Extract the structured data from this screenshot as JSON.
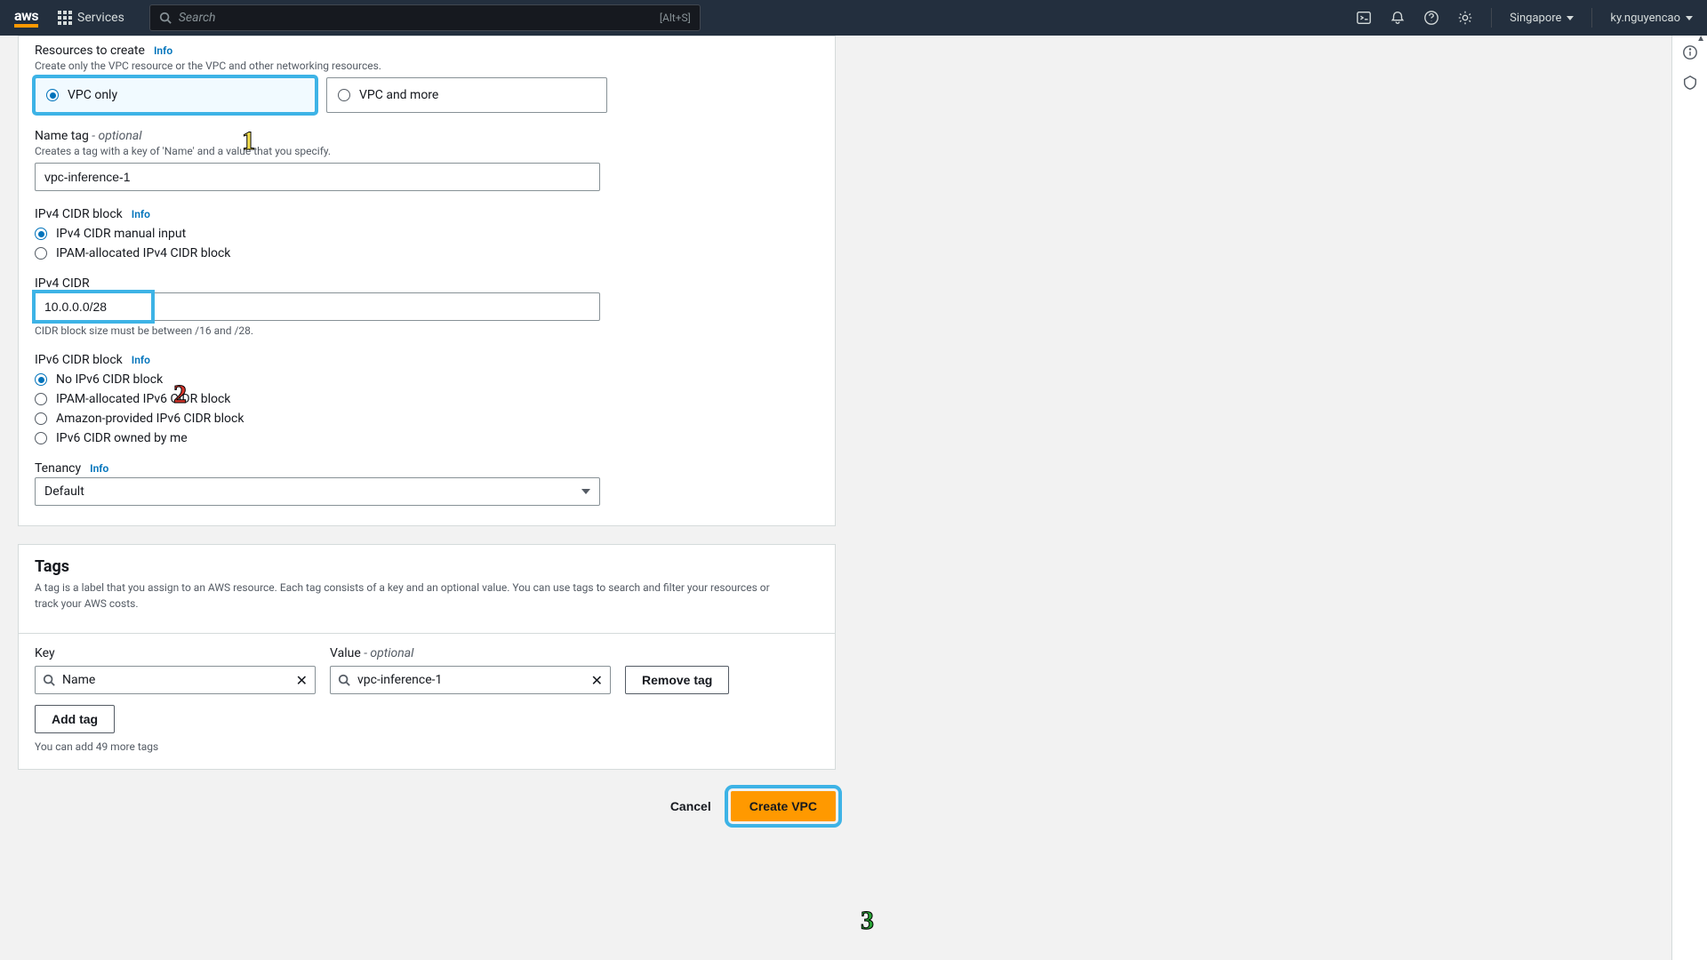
{
  "topnav": {
    "services_label": "Services",
    "search_placeholder": "Search",
    "search_hint": "[Alt+S]",
    "region": "Singapore",
    "username": "ky.nguyencao"
  },
  "form": {
    "resources_label": "Resources to create",
    "resources_hint": "Create only the VPC resource or the VPC and other networking resources.",
    "info_label": "Info",
    "option_vpc_only": "VPC only",
    "option_vpc_and_more": "VPC and more",
    "name_tag_label": "Name tag",
    "optional_text": " - optional",
    "name_tag_hint": "Creates a tag with a key of 'Name' and a value that you specify.",
    "name_tag_value": "vpc-inference-1",
    "ipv4_block_label": "IPv4 CIDR block",
    "ipv4_radio1": "IPv4 CIDR manual input",
    "ipv4_radio2": "IPAM-allocated IPv4 CIDR block",
    "ipv4_cidr_label": "IPv4 CIDR",
    "ipv4_cidr_value": "10.0.0.0/28",
    "ipv4_cidr_hint": "CIDR block size must be between /16 and /28.",
    "ipv6_block_label": "IPv6 CIDR block",
    "ipv6_radio1": "No IPv6 CIDR block",
    "ipv6_radio2": "IPAM-allocated IPv6 CIDR block",
    "ipv6_radio3": "Amazon-provided IPv6 CIDR block",
    "ipv6_radio4": "IPv6 CIDR owned by me",
    "tenancy_label": "Tenancy",
    "tenancy_value": "Default"
  },
  "tags": {
    "title": "Tags",
    "desc": "A tag is a label that you assign to an AWS resource. Each tag consists of a key and an optional value. You can use tags to search and filter your resources or track your AWS costs.",
    "key_label": "Key",
    "value_label": "Value",
    "value_opt": " - optional",
    "key_value": "Name",
    "val_value": "vpc-inference-1",
    "remove_btn": "Remove tag",
    "add_btn": "Add tag",
    "footnote": "You can add 49 more tags"
  },
  "footer": {
    "cancel": "Cancel",
    "create": "Create VPC"
  },
  "callouts": {
    "c1": "1",
    "c2": "2",
    "c3": "3"
  }
}
